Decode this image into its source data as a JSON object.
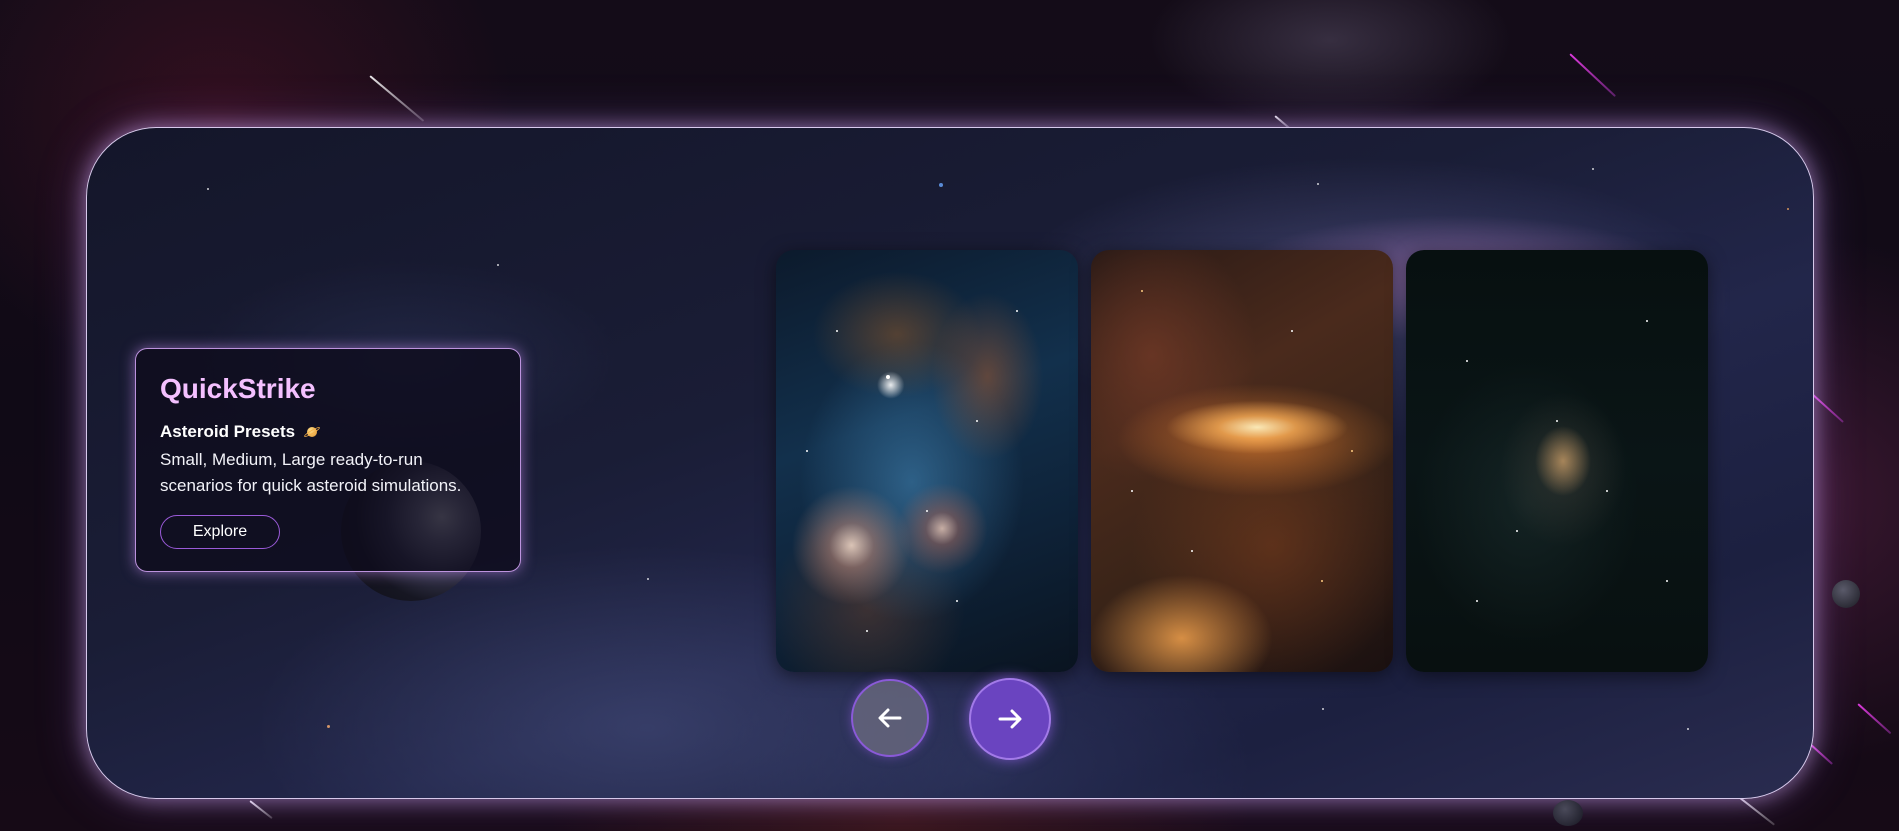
{
  "info_card": {
    "title": "QuickStrike",
    "subtitle": "Asteroid Presets",
    "subtitle_icon": "saturn-icon",
    "description": "Small, Medium, Large ready-to-run scenarios for quick asteroid simulations.",
    "button_label": "Explore"
  },
  "carousel": {
    "cards": [
      {
        "name": "blue-nebula-card"
      },
      {
        "name": "orange-galaxy-card"
      },
      {
        "name": "dark-starfield-card"
      }
    ],
    "prev_icon": "arrow-left-icon",
    "next_icon": "arrow-right-icon"
  },
  "colors": {
    "accent": "#6a44c0",
    "title_pink": "#f4c0ff",
    "border_glow": "#dcaaff"
  }
}
